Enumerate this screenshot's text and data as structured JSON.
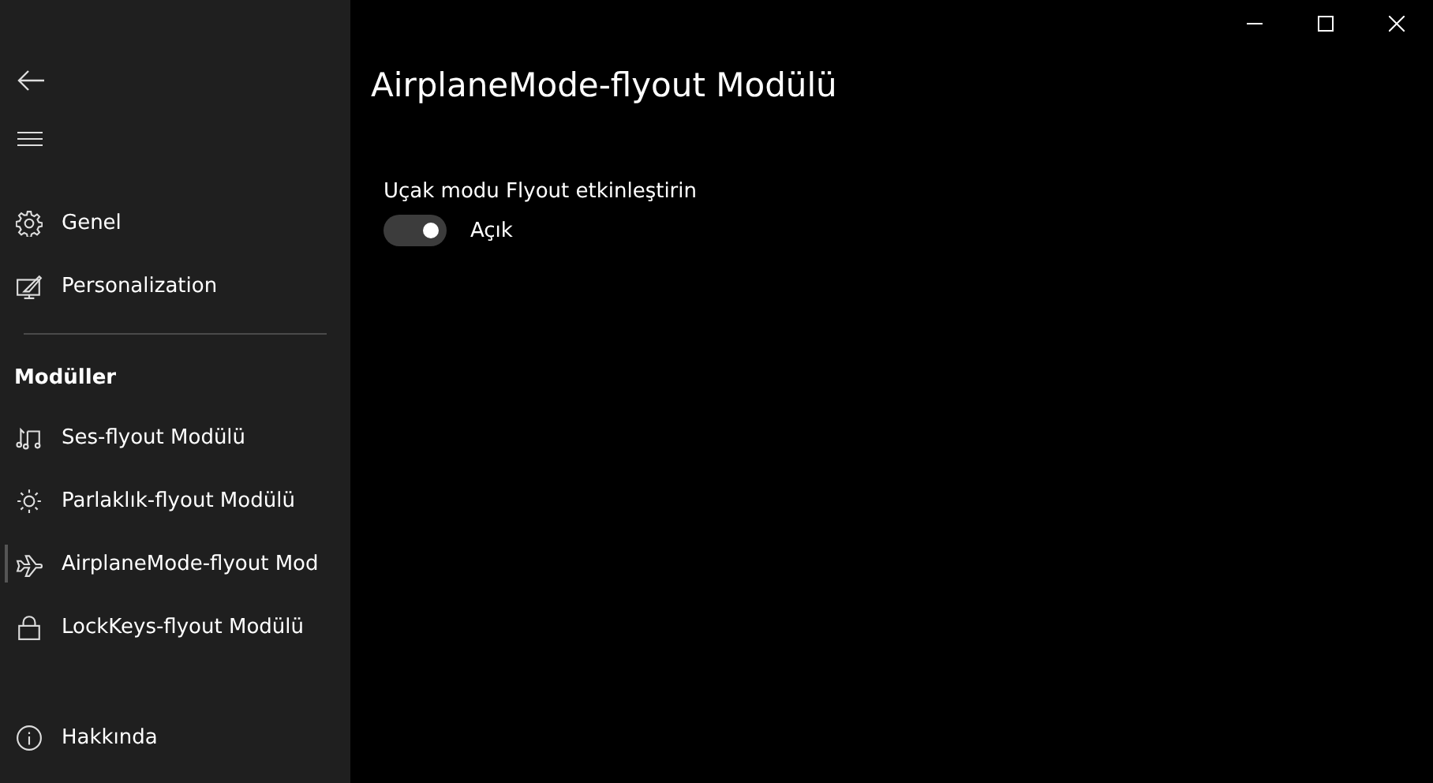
{
  "sidebar": {
    "top_items": [
      {
        "label": "Genel",
        "selected": false
      },
      {
        "label": "Personalization",
        "selected": false
      }
    ],
    "section_header": "Modüller",
    "module_items": [
      {
        "label": "Ses-flyout Modülü",
        "selected": false
      },
      {
        "label": "Parlaklık-flyout Modülü",
        "selected": false
      },
      {
        "label": "AirplaneMode-flyout Mod",
        "selected": true
      },
      {
        "label": "LockKeys-flyout Modülü",
        "selected": false
      }
    ],
    "footer_items": [
      {
        "label": "Hakkında",
        "selected": false
      }
    ]
  },
  "page": {
    "title": "AirplaneMode-flyout Modülü",
    "setting": {
      "label": "Uçak modu Flyout etkinleştirin",
      "on": true,
      "state_text": "Açık"
    }
  }
}
